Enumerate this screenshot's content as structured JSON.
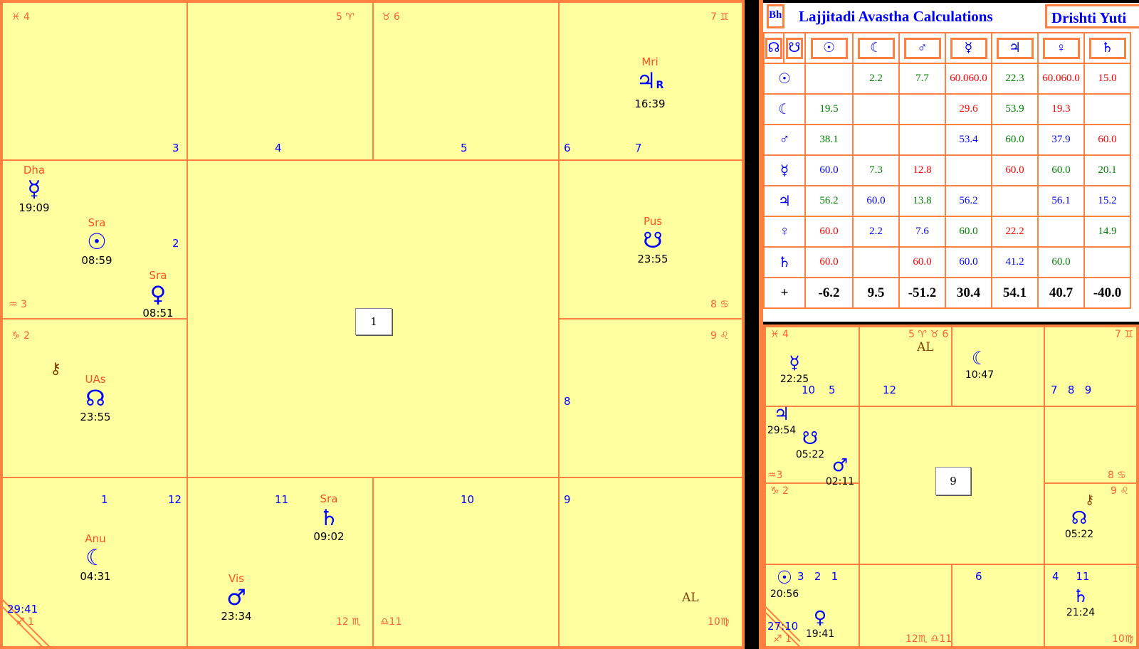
{
  "main_chart": {
    "house_numbers": {
      "h3": "3",
      "h4": "4",
      "h5": "5",
      "h6": "6",
      "h7": "7",
      "h2": "2",
      "h8": "8",
      "h1a": "1",
      "h12": "12",
      "h11": "11",
      "h10": "10",
      "h9": "9"
    },
    "signs": {
      "pisces": "♓ 4",
      "aries": "5 ♈",
      "taurus": "♉ 6",
      "gemini": "7 ♊",
      "aquarius": "♒ 3",
      "cancer": "8 ♋",
      "capricorn": "♑ 2",
      "leo": "9 ♌",
      "sagittarius": "♐ 1",
      "scorpio": "12 ♏",
      "libra": "♎11",
      "virgo": "10♍"
    },
    "planets": {
      "jupiter": {
        "nak": "Mri",
        "glyph": "♃",
        "retro": "R",
        "deg": "16:39"
      },
      "mercury": {
        "nak": "Dha",
        "glyph": "☿",
        "deg": "19:09"
      },
      "sun": {
        "nak": "Sra",
        "glyph": "☉",
        "deg": "08:59"
      },
      "venus": {
        "nak": "Sra",
        "glyph": "♀",
        "deg": "08:51"
      },
      "ketu": {
        "nak": "Pus",
        "glyph": "☋",
        "deg": "23:55"
      },
      "rahu": {
        "nak": "UAs",
        "glyph": "☊",
        "deg": "23:55"
      },
      "moon": {
        "nak": "Anu",
        "glyph": "☾",
        "deg": "04:31"
      },
      "saturn": {
        "nak": "Sra",
        "glyph": "♄",
        "deg": "09:02"
      },
      "mars": {
        "nak": "Vis",
        "glyph": "♂",
        "deg": "23:34"
      }
    },
    "chiron_glyph": "⚷",
    "al": "AL",
    "asc_deg": "29:41",
    "center_label": "1"
  },
  "table": {
    "col0_label": "Bh",
    "title": "Lajjitadi Avastha Calculations",
    "tab_label": "Drishti Yuti",
    "header_row": [
      "☊",
      "☋",
      "☉",
      "☾",
      "♂",
      "☿",
      "♃",
      "♀",
      "♄"
    ],
    "rows": [
      {
        "planet": "☉",
        "cells": [
          [
            "",
            ""
          ],
          [
            "2.2",
            "g"
          ],
          [
            "7.7",
            "g"
          ],
          [
            "60.060.0",
            "r"
          ],
          [
            "22.3",
            "g"
          ],
          [
            "60.060.0",
            "r"
          ],
          [
            "15.0",
            "r"
          ]
        ]
      },
      {
        "planet": "☾",
        "cells": [
          [
            "19.5",
            "g"
          ],
          [
            "",
            ""
          ],
          [
            "",
            ""
          ],
          [
            "29.6",
            "r"
          ],
          [
            "53.9",
            "g"
          ],
          [
            "19.3",
            "r"
          ],
          [
            "",
            ""
          ]
        ]
      },
      {
        "planet": "♂",
        "cells": [
          [
            "38.1",
            "g"
          ],
          [
            "",
            ""
          ],
          [
            "",
            ""
          ],
          [
            "53.4",
            "b"
          ],
          [
            "60.0",
            "g"
          ],
          [
            "37.9",
            "b"
          ],
          [
            "60.0",
            "r"
          ]
        ]
      },
      {
        "planet": "☿",
        "cells": [
          [
            "60.0",
            "b"
          ],
          [
            "7.3",
            "g"
          ],
          [
            "12.8",
            "r"
          ],
          [
            "",
            ""
          ],
          [
            "60.0",
            "r"
          ],
          [
            "60.0",
            "g"
          ],
          [
            "20.1",
            "g"
          ]
        ]
      },
      {
        "planet": "♃",
        "cells": [
          [
            "56.2",
            "g"
          ],
          [
            "60.0",
            "b"
          ],
          [
            "13.8",
            "g"
          ],
          [
            "56.2",
            "b"
          ],
          [
            "",
            ""
          ],
          [
            "56.1",
            "b"
          ],
          [
            "15.2",
            "b"
          ]
        ]
      },
      {
        "planet": "♀",
        "cells": [
          [
            "60.0",
            "r"
          ],
          [
            "2.2",
            "b"
          ],
          [
            "7.6",
            "b"
          ],
          [
            "60.0",
            "g"
          ],
          [
            "22.2",
            "r"
          ],
          [
            "",
            ""
          ],
          [
            "14.9",
            "g"
          ]
        ]
      },
      {
        "planet": "♄",
        "cells": [
          [
            "60.0",
            "r"
          ],
          [
            "",
            ""
          ],
          [
            "60.0",
            "r"
          ],
          [
            "60.0",
            "b"
          ],
          [
            "41.2",
            "b"
          ],
          [
            "60.0",
            "g"
          ],
          [
            "",
            ""
          ]
        ]
      }
    ],
    "totals_label": "+",
    "totals": [
      "-6.2",
      "9.5",
      "-51.2",
      "30.4",
      "54.1",
      "40.7",
      "-40.0"
    ]
  },
  "navamsa_chart": {
    "signs": {
      "pisces": "♓ 4",
      "aries_taurus": "5 ♈ ♉ 6",
      "gemini": "7 ♊",
      "aquarius": "♒3",
      "cancer": "8 ♋",
      "capricorn": "♑ 2",
      "leo": "9 ♌",
      "sagittarius": "♐ 1",
      "scorpio_libra": "12♏ ♎11",
      "virgo": "10♍"
    },
    "house_numbers": {
      "n10": "10",
      "n5": "5",
      "n12": "12",
      "n789": "7   8   9",
      "n321": "3   2   1",
      "n6": "6",
      "n4_11": "4     11"
    },
    "planets": {
      "mercury": {
        "glyph": "☿",
        "deg": "22:25"
      },
      "moon": {
        "glyph": "☾",
        "deg": "10:47"
      },
      "jupiter": {
        "glyph": "♃",
        "deg": "29:54"
      },
      "ketu": {
        "glyph": "☋",
        "deg": "05:22"
      },
      "mars": {
        "glyph": "♂",
        "deg": "02:11"
      },
      "rahu": {
        "glyph": "☊",
        "deg": "05:22"
      },
      "sun": {
        "glyph": "☉",
        "deg": "20:56"
      },
      "venus": {
        "glyph": "♀",
        "deg": "19:41"
      },
      "saturn": {
        "glyph": "♄",
        "deg": "21:24"
      }
    },
    "chiron_glyph": "⚷",
    "al": "AL",
    "asc_deg": "27:10",
    "center_label": "9"
  }
}
